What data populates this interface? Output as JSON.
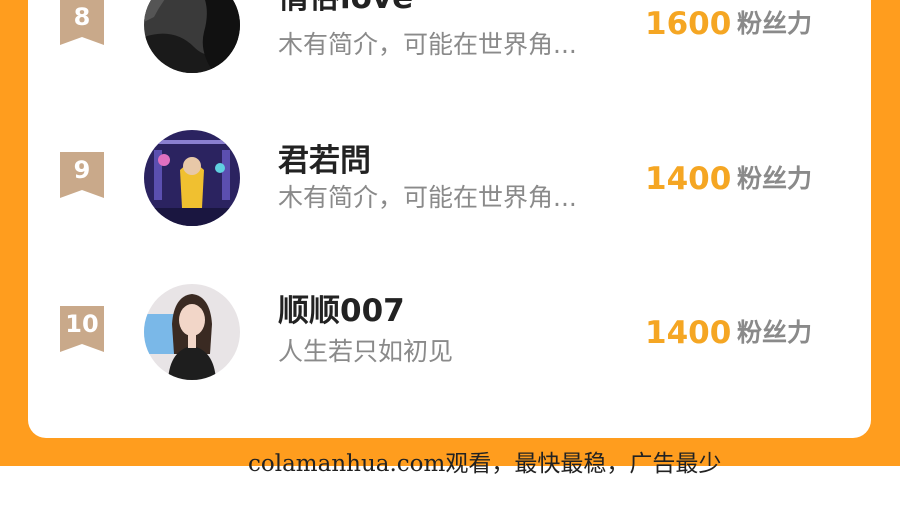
{
  "colors": {
    "frame": "#ff9d1e",
    "card": "#ffffff",
    "badge": "#c9a98a",
    "score": "#f5a623",
    "name": "#222222",
    "muted": "#8a8a8a"
  },
  "ranking": {
    "score_unit": "粉丝力",
    "entries": [
      {
        "rank": "8",
        "name": "情俗love",
        "bio": "木有简介，可能在世界角...",
        "score": "1600",
        "avatar_icon": "dark-portrait-avatar"
      },
      {
        "rank": "9",
        "name": "君若問",
        "bio": "木有简介，可能在世界角...",
        "score": "1400",
        "avatar_icon": "stage-performer-avatar"
      },
      {
        "rank": "10",
        "name": "顺顺007",
        "bio": "人生若只如初见",
        "score": "1400",
        "avatar_icon": "selfie-avatar"
      }
    ]
  },
  "footer": {
    "watermark": "colamanhua.com观看，最快最稳，广告最少"
  }
}
